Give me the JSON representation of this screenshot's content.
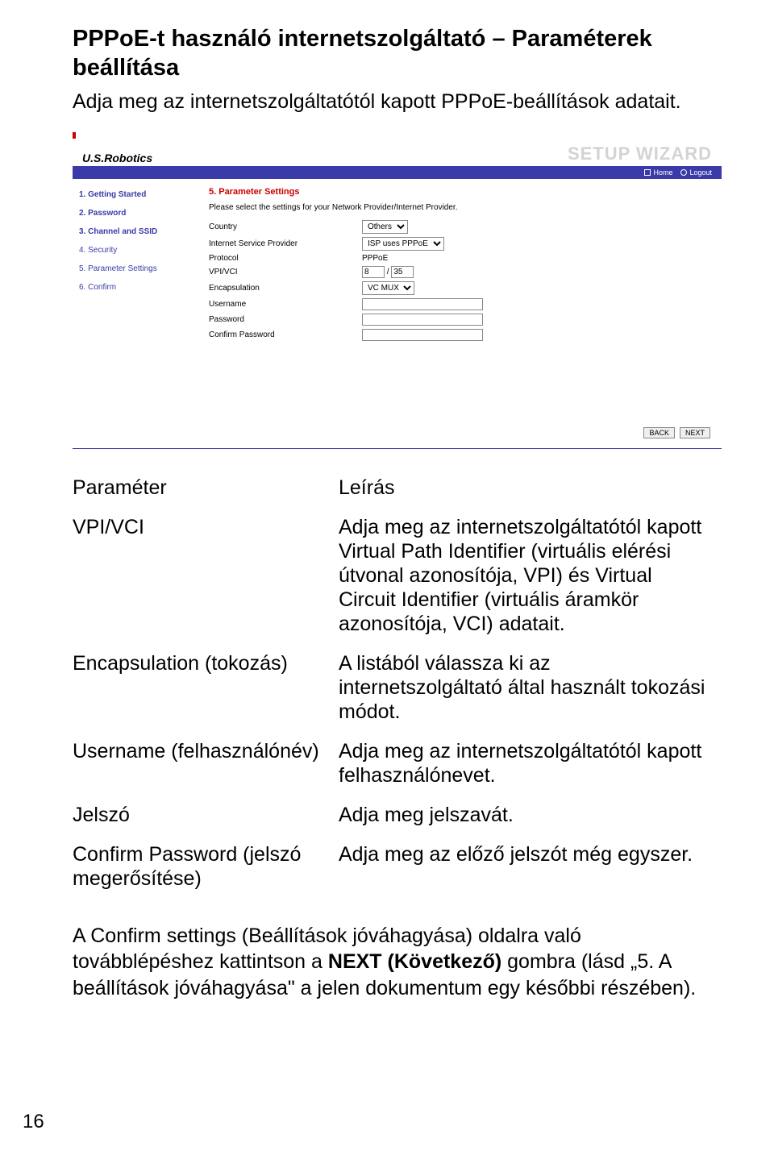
{
  "heading": "PPPoE-t használó internetszolgáltató – Paraméterek beállítása",
  "intro": "Adja meg az internetszolgáltatótól kapott PPPoE-beállítások adatait.",
  "screenshot": {
    "brand": "U.S.Robotics",
    "wizard_title": "SETUP WIZARD",
    "home": "Home",
    "logout": "Logout",
    "sidebar": {
      "steps": [
        "1. Getting Started",
        "2. Password",
        "3. Channel and SSID",
        "4. Security",
        "5. Parameter Settings",
        "6. Confirm"
      ]
    },
    "section_title": "5. Parameter Settings",
    "section_desc": "Please select the settings for your Network Provider/Internet Provider.",
    "rows": {
      "country_lbl": "Country",
      "country_val": "Others",
      "isp_lbl": "Internet Service Provider",
      "isp_val": "ISP uses PPPoE",
      "proto_lbl": "Protocol",
      "proto_val": "PPPoE",
      "vpivci_lbl": "VPI/VCI",
      "vpi_val": "8",
      "vci_val": "35",
      "encap_lbl": "Encapsulation",
      "encap_val": "VC MUX",
      "user_lbl": "Username",
      "user_val": "",
      "pass_lbl": "Password",
      "pass_val": "",
      "confpass_lbl": "Confirm Password",
      "confpass_val": ""
    },
    "back": "BACK",
    "next": "NEXT"
  },
  "param_table": {
    "head_param": "Paraméter",
    "head_desc": "Leírás",
    "rows": [
      {
        "p": "VPI/VCI",
        "d": "Adja meg az internetszolgáltatótól kapott Virtual Path Identifier (virtuális elérési útvonal azonosítója, VPI) és Virtual Circuit Identifier (virtuális áramkör azonosítója, VCI) adatait."
      },
      {
        "p": "Encapsulation (tokozás)",
        "d": "A listából válassza ki az internetszolgáltató által használt tokozási módot."
      },
      {
        "p": "Username (felhasználónév)",
        "d": "Adja meg az internetszolgáltatótól kapott felhasználónevet."
      },
      {
        "p": "Jelszó",
        "d": "Adja meg jelszavát."
      },
      {
        "p": "Confirm Password (jelszó megerősítése)",
        "d": "Adja meg az előző jelszót még egyszer."
      }
    ]
  },
  "outro_1": "A Confirm settings (Beállítások jóváhagyása) oldalra való továbblépéshez kattintson a ",
  "outro_bold": "NEXT (Következő)",
  "outro_2": " gombra (lásd „5. A beállítások jóváhagyása\" a jelen dokumentum egy későbbi részében).",
  "pagenum": "16"
}
